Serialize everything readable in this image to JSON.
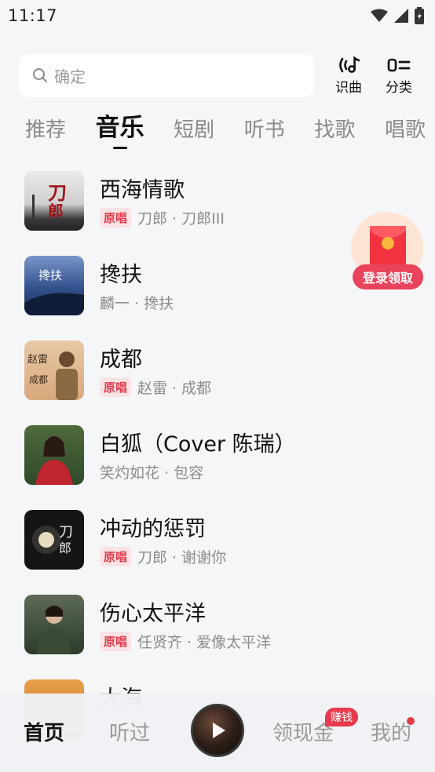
{
  "status_bar": {
    "time": "11:17"
  },
  "search": {
    "placeholder": "确定"
  },
  "actions": {
    "identify": "识曲",
    "category": "分类"
  },
  "tabs": [
    "推荐",
    "音乐",
    "短剧",
    "听书",
    "找歌",
    "唱歌"
  ],
  "songs": [
    {
      "title": "西海情歌",
      "badge": "原唱",
      "artist": "刀郎 · 刀郎III"
    },
    {
      "title": "搀扶",
      "badge": "",
      "artist": "麟一 · 搀扶"
    },
    {
      "title": "成都",
      "badge": "原唱",
      "artist": "赵雷 · 成都"
    },
    {
      "title": "白狐（Cover 陈瑞）",
      "badge": "",
      "artist": "笑灼如花 · 包容"
    },
    {
      "title": "冲动的惩罚",
      "badge": "原唱",
      "artist": "刀郎 · 谢谢你"
    },
    {
      "title": "伤心太平洋",
      "badge": "原唱",
      "artist": "任贤齐 · 爱像太平洋"
    },
    {
      "title": "大海",
      "badge": "",
      "artist": ""
    }
  ],
  "redpacket": {
    "label": "登录领取"
  },
  "bottom_nav": {
    "home": "首页",
    "history": "听过",
    "earn": "领现金",
    "earn_badge": "赚钱",
    "mine": "我的"
  },
  "colors": {
    "accent": "#e23a4b",
    "badge_bg": "#fbe3e5"
  }
}
